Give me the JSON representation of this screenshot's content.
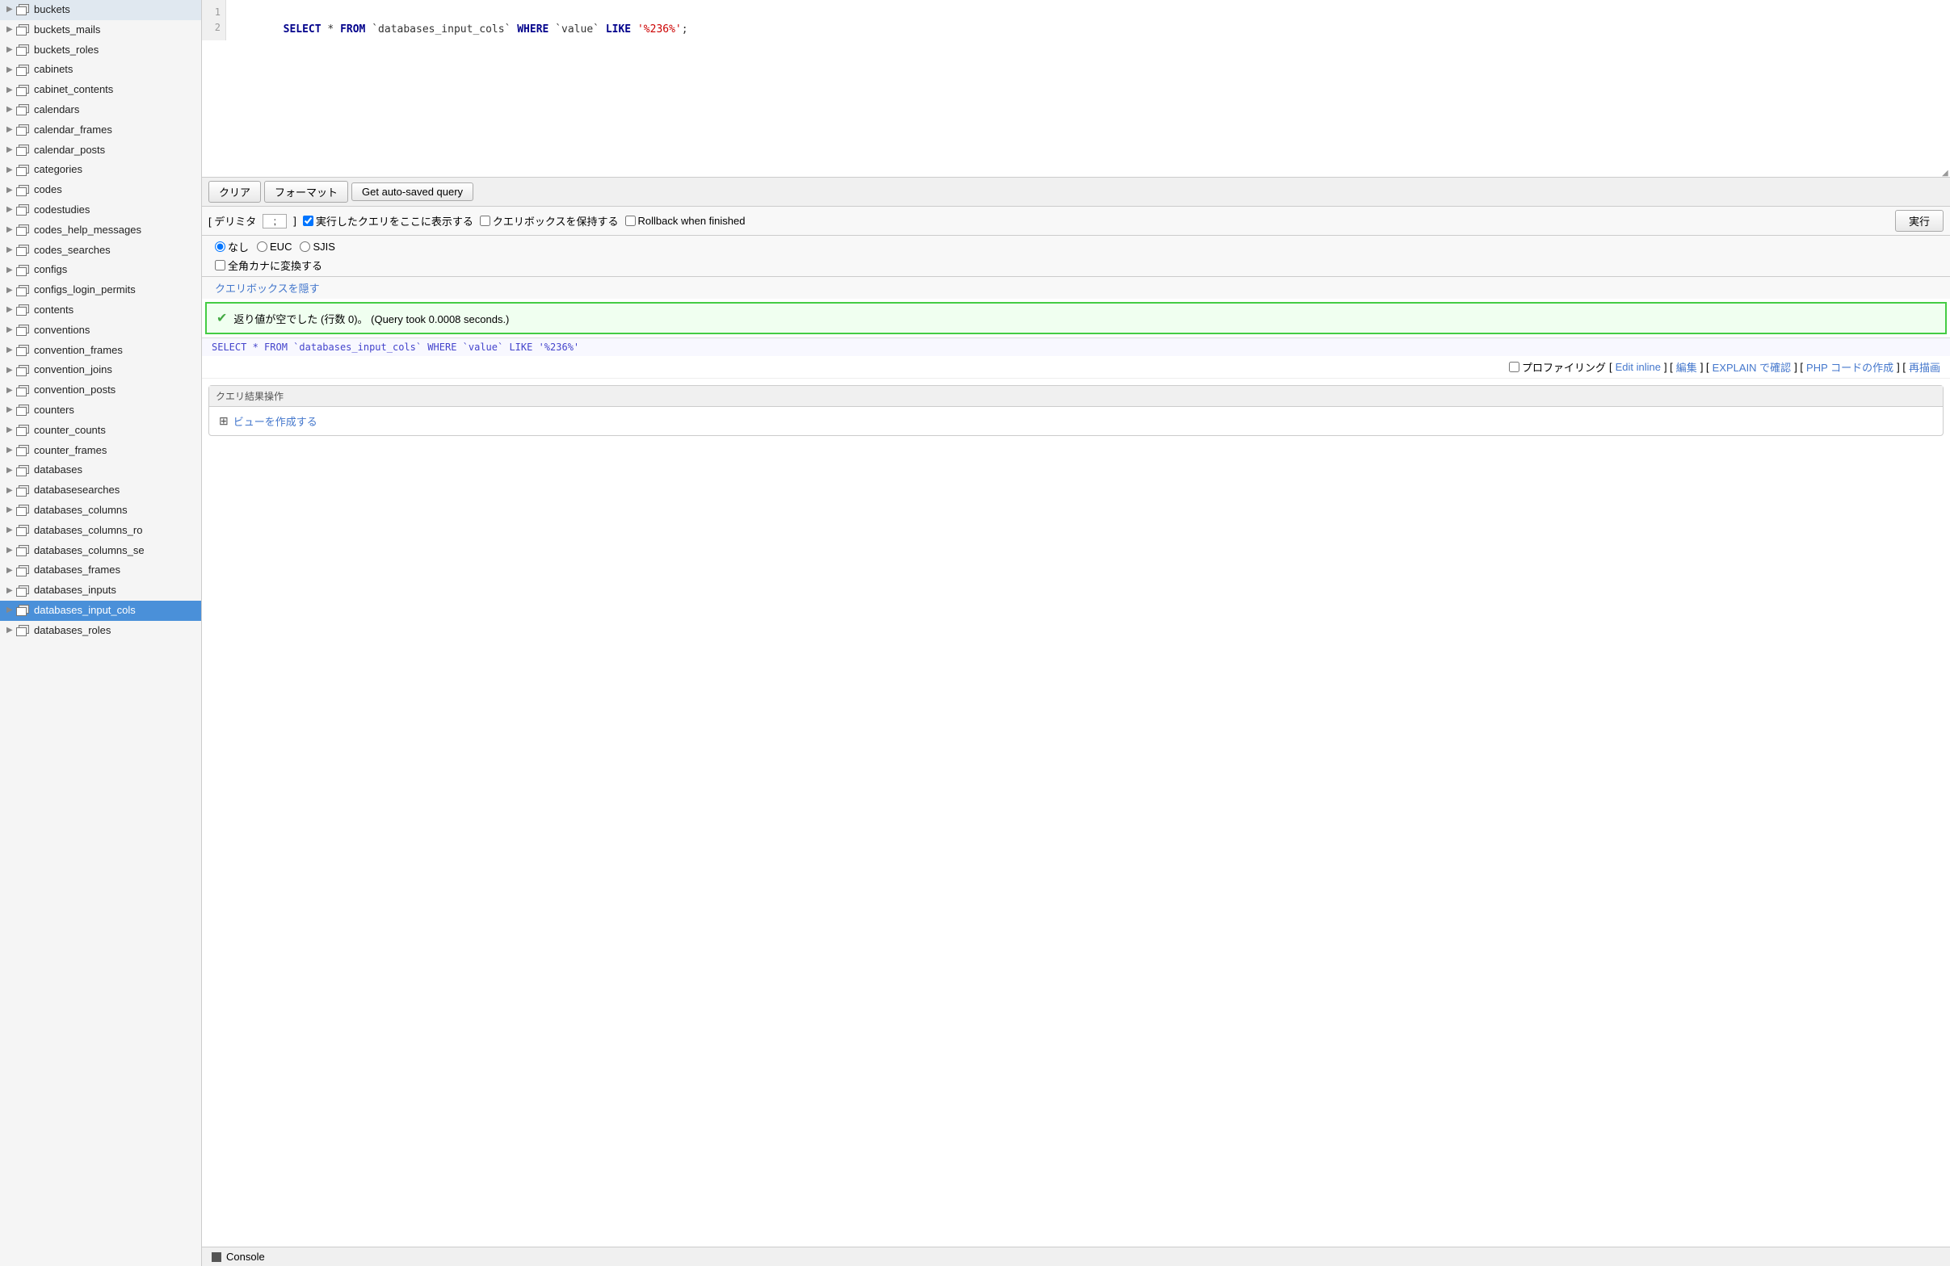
{
  "sidebar": {
    "items": [
      {
        "label": "buckets",
        "selected": false
      },
      {
        "label": "buckets_mails",
        "selected": false
      },
      {
        "label": "buckets_roles",
        "selected": false
      },
      {
        "label": "cabinets",
        "selected": false
      },
      {
        "label": "cabinet_contents",
        "selected": false
      },
      {
        "label": "calendars",
        "selected": false
      },
      {
        "label": "calendar_frames",
        "selected": false
      },
      {
        "label": "calendar_posts",
        "selected": false
      },
      {
        "label": "categories",
        "selected": false
      },
      {
        "label": "codes",
        "selected": false
      },
      {
        "label": "codestudies",
        "selected": false
      },
      {
        "label": "codes_help_messages",
        "selected": false
      },
      {
        "label": "codes_searches",
        "selected": false
      },
      {
        "label": "configs",
        "selected": false
      },
      {
        "label": "configs_login_permits",
        "selected": false
      },
      {
        "label": "contents",
        "selected": false
      },
      {
        "label": "conventions",
        "selected": false
      },
      {
        "label": "convention_frames",
        "selected": false
      },
      {
        "label": "convention_joins",
        "selected": false
      },
      {
        "label": "convention_posts",
        "selected": false
      },
      {
        "label": "counters",
        "selected": false
      },
      {
        "label": "counter_counts",
        "selected": false
      },
      {
        "label": "counter_frames",
        "selected": false
      },
      {
        "label": "databases",
        "selected": false
      },
      {
        "label": "databasesearches",
        "selected": false
      },
      {
        "label": "databases_columns",
        "selected": false
      },
      {
        "label": "databases_columns_ro",
        "selected": false
      },
      {
        "label": "databases_columns_se",
        "selected": false
      },
      {
        "label": "databases_frames",
        "selected": false
      },
      {
        "label": "databases_inputs",
        "selected": false
      },
      {
        "label": "databases_input_cols",
        "selected": true
      },
      {
        "label": "databases_roles",
        "selected": false
      }
    ]
  },
  "editor": {
    "line1": "SELECT * FROM `databases_input_cols` WHERE `value` LIKE '%236%';",
    "line2": ""
  },
  "toolbar": {
    "clear_label": "クリア",
    "format_label": "フォーマット",
    "autosave_label": "Get auto-saved query"
  },
  "options": {
    "delimiter_label": "[ デリミタ",
    "delimiter_value": ";",
    "delimiter_end": "]",
    "show_query_label": "実行したクエリをここに表示する",
    "keep_querybox_label": "クエリボックスを保持する",
    "rollback_label": "Rollback when finished",
    "run_label": "実行"
  },
  "encoding": {
    "none_label": "なし",
    "euc_label": "EUC",
    "sjis_label": "SJIS",
    "fullwidth_label": "全角カナに変換する"
  },
  "hide_querybox_label": "クエリボックスを隠す",
  "result": {
    "success_message": "返り値が空でした (行数 0)。 (Query took 0.0008 seconds.)",
    "query_shown": "SELECT * FROM `databases_input_cols` WHERE `value` LIKE '%236%'",
    "profiling_label": "プロファイリング",
    "edit_inline_label": "Edit inline",
    "edit_label": "編集",
    "explain_label": "EXPLAIN で確認",
    "php_label": "PHP コードの作成",
    "redraw_label": "再描画"
  },
  "query_result_ops": {
    "title": "クエリ結果操作",
    "create_view_label": "ビューを作成する"
  },
  "console": {
    "label": "Console"
  }
}
